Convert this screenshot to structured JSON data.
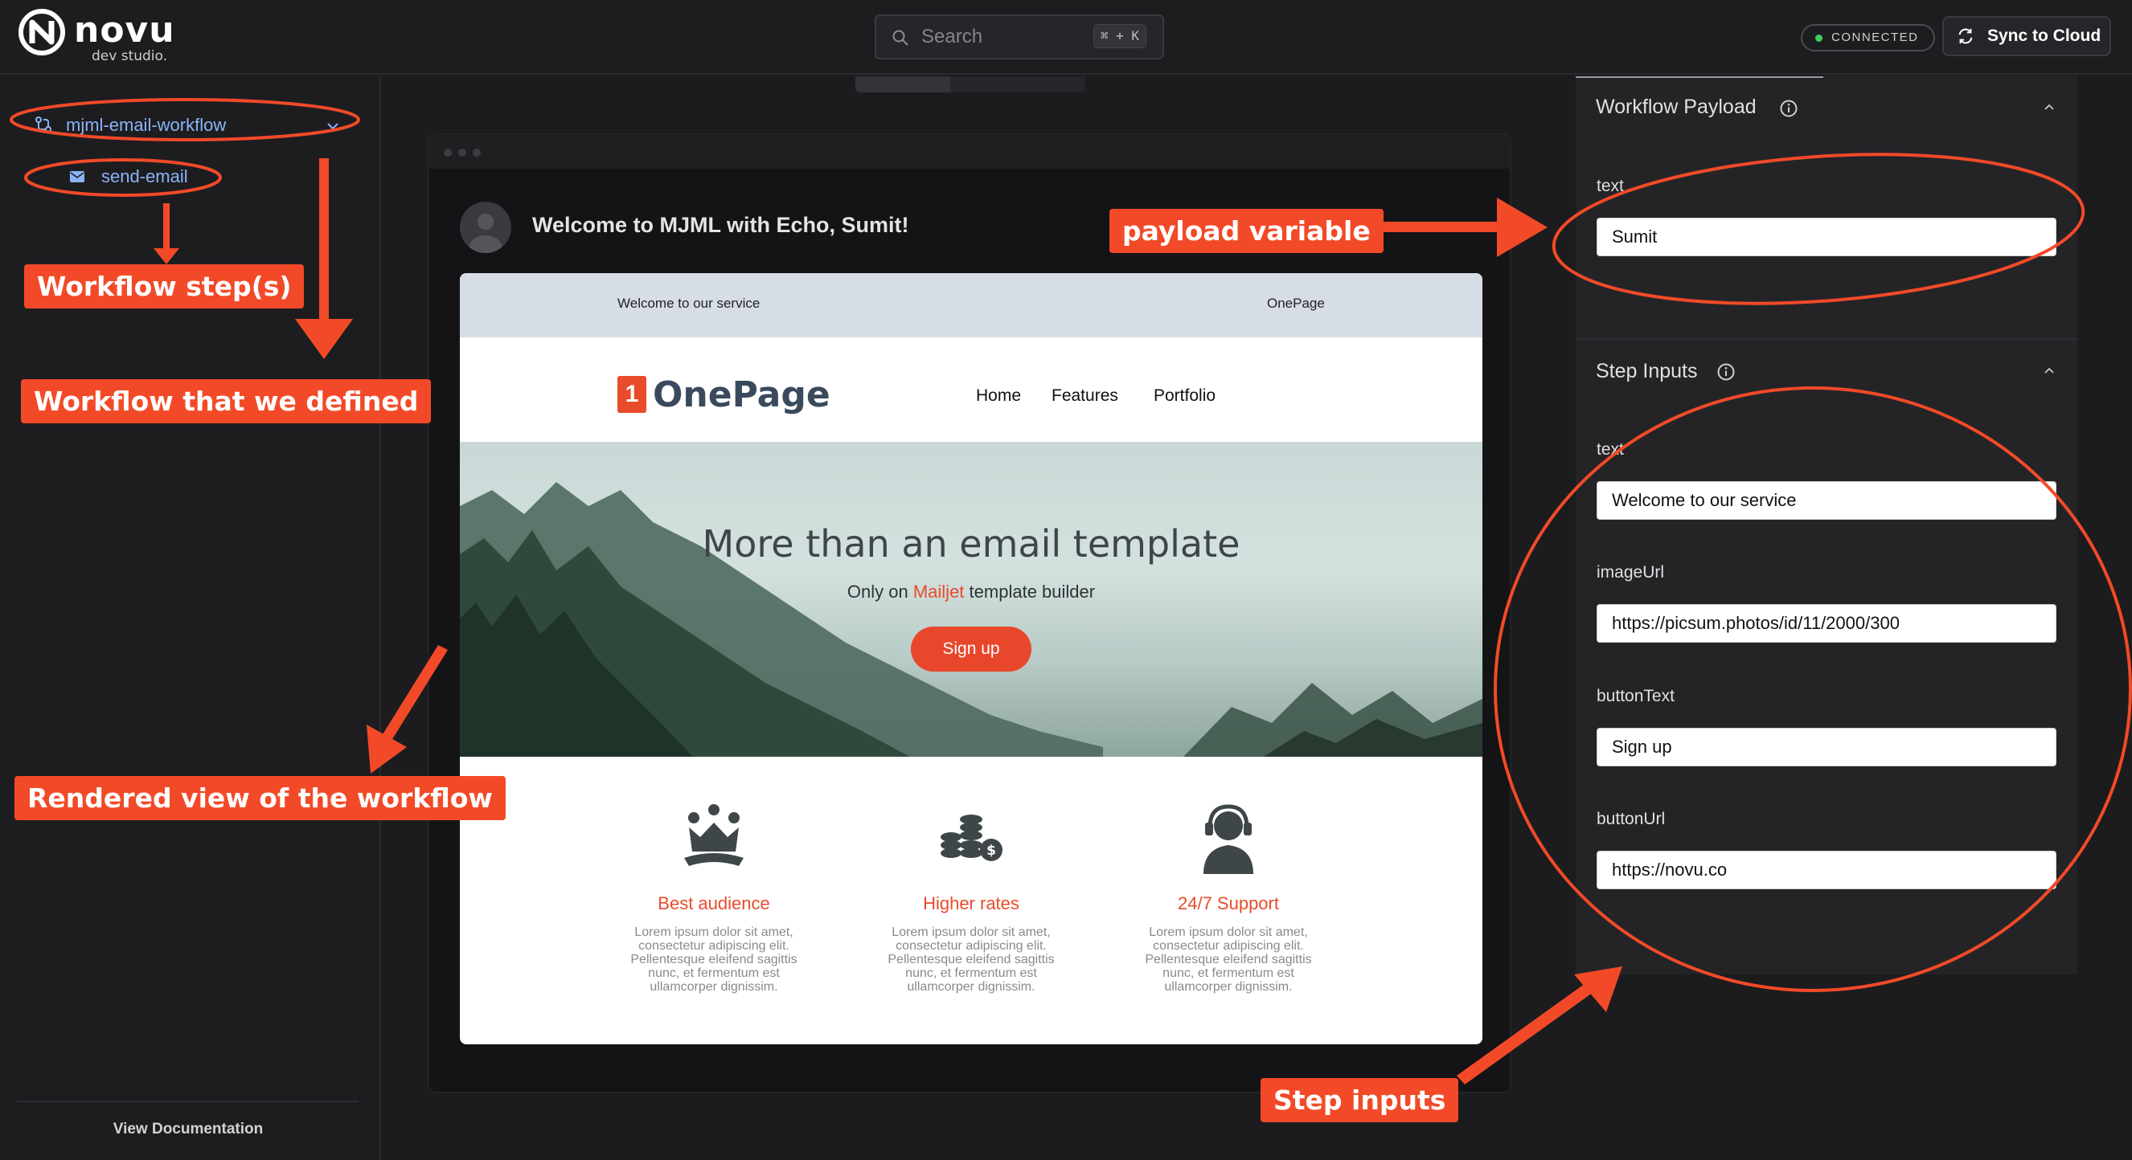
{
  "header": {
    "brand_name": "novu",
    "brand_sub": "dev studio.",
    "search_placeholder": "Search",
    "search_shortcut": "⌘ + K",
    "status": "CONNECTED",
    "sync_label": "Sync to Cloud"
  },
  "sidebar": {
    "workflow_label": "mjml-email-workflow",
    "step_label": "send-email",
    "docs_label": "View Documentation"
  },
  "preview": {
    "subject": "Welcome to MJML with Echo, Sumit!",
    "email": {
      "top_left": "Welcome to our service",
      "top_right": "OnePage",
      "brand_number": "1",
      "brand_name": "OnePage",
      "nav": [
        "Home",
        "Features",
        "Portfolio"
      ],
      "hero_title": "More than an email template",
      "hero_sub_before": "Only on",
      "hero_sub_accent": "Mailjet",
      "hero_sub_after": "template builder",
      "hero_button": "Sign up",
      "features": [
        {
          "icon": "crown-icon",
          "title": "Best audience",
          "text": "Lorem ipsum dolor sit amet, consectetur adipiscing elit. Pellentesque eleifend sagittis nunc, et fermentum est ullamcorper dignissim."
        },
        {
          "icon": "coins-icon",
          "title": "Higher rates",
          "text": "Lorem ipsum dolor sit amet, consectetur adipiscing elit. Pellentesque eleifend sagittis nunc, et fermentum est ullamcorper dignissim."
        },
        {
          "icon": "support-headset-icon",
          "title": "24/7 Support",
          "text": "Lorem ipsum dolor sit amet, consectetur adipiscing elit. Pellentesque eleifend sagittis nunc, et fermentum est ullamcorper dignissim."
        }
      ]
    }
  },
  "right_panel": {
    "payload": {
      "title": "Workflow Payload",
      "fields": [
        {
          "label": "text",
          "value": "Sumit"
        }
      ]
    },
    "step_inputs": {
      "title": "Step Inputs",
      "fields": [
        {
          "label": "text",
          "value": "Welcome to our service"
        },
        {
          "label": "imageUrl",
          "value": "https://picsum.photos/id/11/2000/300"
        },
        {
          "label": "buttonText",
          "value": "Sign up"
        },
        {
          "label": "buttonUrl",
          "value": "https://novu.co"
        }
      ]
    }
  },
  "annotations": {
    "workflow_steps": "Workflow step(s)",
    "workflow_defined": "Workflow that we defined",
    "rendered_view": "Rendered view of the workflow",
    "payload_variable": "payload variable",
    "step_inputs": "Step inputs"
  },
  "colors": {
    "annotation": "#f24a28",
    "link": "#8ab4f8",
    "email_accent": "#e84c2b",
    "connected_dot": "#3fcf5a"
  }
}
